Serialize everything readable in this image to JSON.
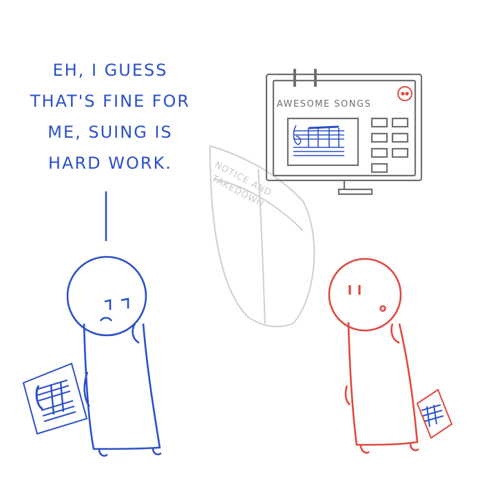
{
  "speech_bubble": {
    "lines": [
      "EH, I GUESS",
      "THAT'S FINE FOR",
      "ME, SUING IS",
      "HARD WORK."
    ]
  },
  "monitor": {
    "title": "AWESOME SONGS"
  },
  "shield": {
    "line1": "NOTICE AND",
    "line2": "TAKEDOWN"
  },
  "colors": {
    "blue_character": "#2b4fc9",
    "red_character": "#e0483f",
    "sketch_gray": "#6f6f6f",
    "faded_gray": "#c9c9c9"
  }
}
